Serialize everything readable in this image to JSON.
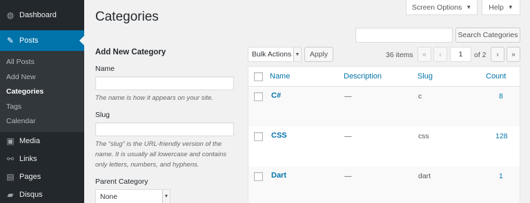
{
  "sidebar": {
    "items": [
      {
        "label": "Dashboard",
        "icon": "dashboard-icon",
        "glyph": "◍"
      },
      {
        "label": "Posts",
        "icon": "pin-icon",
        "glyph": "📌",
        "active": true
      },
      {
        "label": "Media",
        "icon": "media-icon",
        "glyph": "▣"
      },
      {
        "label": "Links",
        "icon": "link-icon",
        "glyph": "⛓"
      },
      {
        "label": "Pages",
        "icon": "pages-icon",
        "glyph": "▤"
      },
      {
        "label": "Disqus",
        "icon": "comment-icon",
        "glyph": "▰"
      }
    ],
    "submenu": [
      "All Posts",
      "Add New",
      "Categories",
      "Tags",
      "Calendar"
    ]
  },
  "header": {
    "screen_options": "Screen Options",
    "help": "Help",
    "title": "Categories"
  },
  "search": {
    "value": "",
    "button": "Search Categories"
  },
  "form": {
    "heading": "Add New Category",
    "name_label": "Name",
    "name_value": "",
    "name_desc": "The name is how it appears on your site.",
    "slug_label": "Slug",
    "slug_value": "",
    "slug_desc": "The “slug” is the URL-friendly version of the name. It is usually all lowercase and contains only letters, numbers, and hyphens.",
    "parent_label": "Parent Category",
    "parent_value": "None"
  },
  "tablenav": {
    "bulk_actions": "Bulk Actions",
    "apply": "Apply",
    "items_count": "36 items",
    "first": "«",
    "prev": "‹",
    "current_page": "1",
    "of_pages": "of 2",
    "next": "›",
    "last": "»"
  },
  "table": {
    "columns": {
      "name": "Name",
      "description": "Description",
      "slug": "Slug",
      "count": "Count"
    },
    "rows": [
      {
        "name": "C#",
        "description": "—",
        "slug": "c",
        "count": "8"
      },
      {
        "name": "CSS",
        "description": "—",
        "slug": "css",
        "count": "128"
      },
      {
        "name": "Dart",
        "description": "—",
        "slug": "dart",
        "count": "1"
      }
    ]
  },
  "colors": {
    "sidebar_bg": "#23282d",
    "accent": "#0073aa",
    "page_bg": "#f1f1f1"
  }
}
